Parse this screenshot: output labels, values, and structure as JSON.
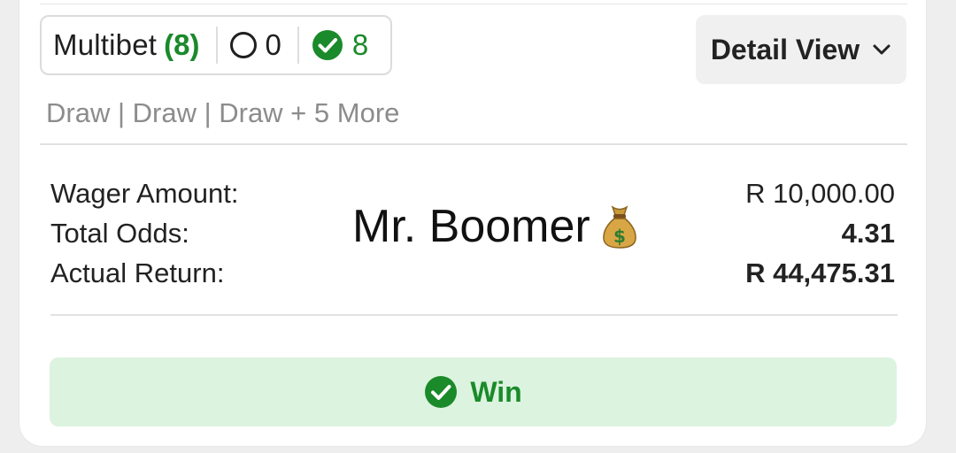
{
  "bet": {
    "type_label": "Multibet",
    "leg_count": "(8)",
    "pending_count": "0",
    "won_count": "8",
    "detail_button": "Detail View",
    "selections": "Draw | Draw | Draw + 5 More"
  },
  "summary": {
    "wager_label": "Wager Amount:",
    "wager_value": "R 10,000.00",
    "odds_label": "Total Odds:",
    "odds_value": "4.31",
    "return_label": "Actual Return:",
    "return_value": "R 44,475.31"
  },
  "overlay": {
    "text": "Mr. Boomer",
    "icon": "money-bag-emoji"
  },
  "status": {
    "label": "Win",
    "icon": "check-circle-icon"
  },
  "colors": {
    "win_green": "#1a8a2a",
    "win_bg": "#dcf3df",
    "muted": "#8c8c8c"
  }
}
